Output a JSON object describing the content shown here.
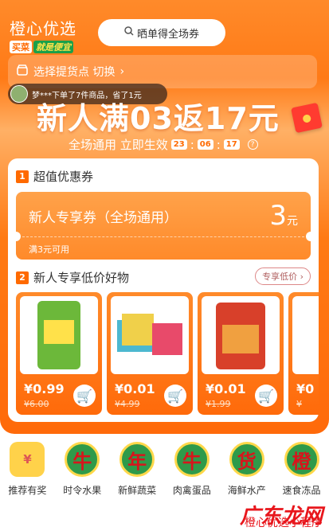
{
  "header": {
    "logo_title": "橙心优选",
    "logo_tag_a": "买菜",
    "logo_tag_b": "就是便宜",
    "search_placeholder": "晒单得全场券"
  },
  "pickup": {
    "label": "选择提货点 切换",
    "icon": "store-icon"
  },
  "toast": {
    "text": "梦***下单了7件商品，省了1元"
  },
  "hero": {
    "headline": "新人满03返17元",
    "subline": "全场通用 立即生效",
    "timer": [
      "23",
      "06",
      "17"
    ]
  },
  "coupon_section": {
    "index": "1",
    "title": "超值优惠券",
    "coupon_name": "新人专享券（全场通用）",
    "amount": "3",
    "unit": "元",
    "condition": "满3元可用"
  },
  "products_section": {
    "index": "2",
    "title": "新人专享低价好物",
    "more_label": "专享低价",
    "items": [
      {
        "price": "¥0.99",
        "orig": "¥6.00",
        "color": "#6cb83a"
      },
      {
        "price": "¥0.01",
        "orig": "¥4.99",
        "color": "#4cb8d0"
      },
      {
        "price": "¥0.01",
        "orig": "¥1.99",
        "color": "#d8402a"
      },
      {
        "price": "¥0",
        "orig": "¥",
        "color": "#c9c9c9"
      }
    ]
  },
  "nav": [
    {
      "label": "推荐有奖",
      "glyph": "¥"
    },
    {
      "label": "时令水果",
      "glyph": "牛"
    },
    {
      "label": "新鲜蔬菜",
      "glyph": "年"
    },
    {
      "label": "肉禽蛋品",
      "glyph": "牛"
    },
    {
      "label": "海鲜水产",
      "glyph": "货"
    },
    {
      "label": "速食冻品",
      "glyph": "橙"
    }
  ],
  "watermark": {
    "main": "广东龙网",
    "sub": "橙心优选小程序"
  }
}
